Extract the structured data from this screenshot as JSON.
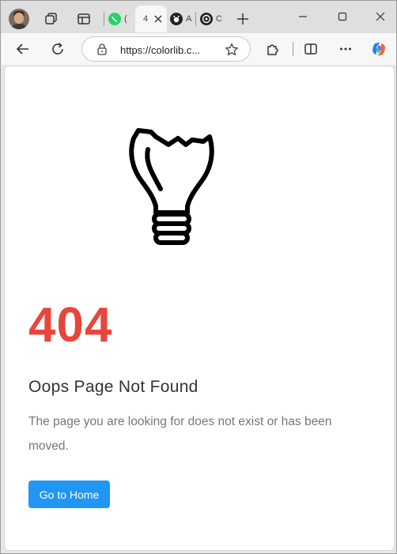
{
  "browser": {
    "tabs": [
      {
        "letter": "(",
        "favicon": "whatsapp-icon",
        "color": "#25d366"
      },
      {
        "letter": "4",
        "favicon": "",
        "active": true
      },
      {
        "letter": "A",
        "favicon": "github-icon"
      },
      {
        "letter": "C",
        "favicon": "chatgpt-icon"
      }
    ],
    "address": {
      "url": "https://colorlib.c..."
    },
    "icons": {
      "workspaces": "workspaces-icon",
      "tab_actions": "tab-actions-icon",
      "new_tab": "plus-icon",
      "back": "back-arrow-icon",
      "refresh": "refresh-icon",
      "site_info": "lock-icon",
      "favorite": "star-icon",
      "extensions": "puzzle-icon",
      "split": "split-screen-icon",
      "more": "more-icon",
      "copilot": "copilot-icon"
    }
  },
  "page": {
    "code": "404",
    "headline": "Oops Page Not Found",
    "description": "The page you are looking for does not exist or has been moved.",
    "button_label": "Go to Home",
    "colors": {
      "code": "#e8453c",
      "button": "#2196f3"
    },
    "illustration": "broken-lightbulb-icon"
  }
}
